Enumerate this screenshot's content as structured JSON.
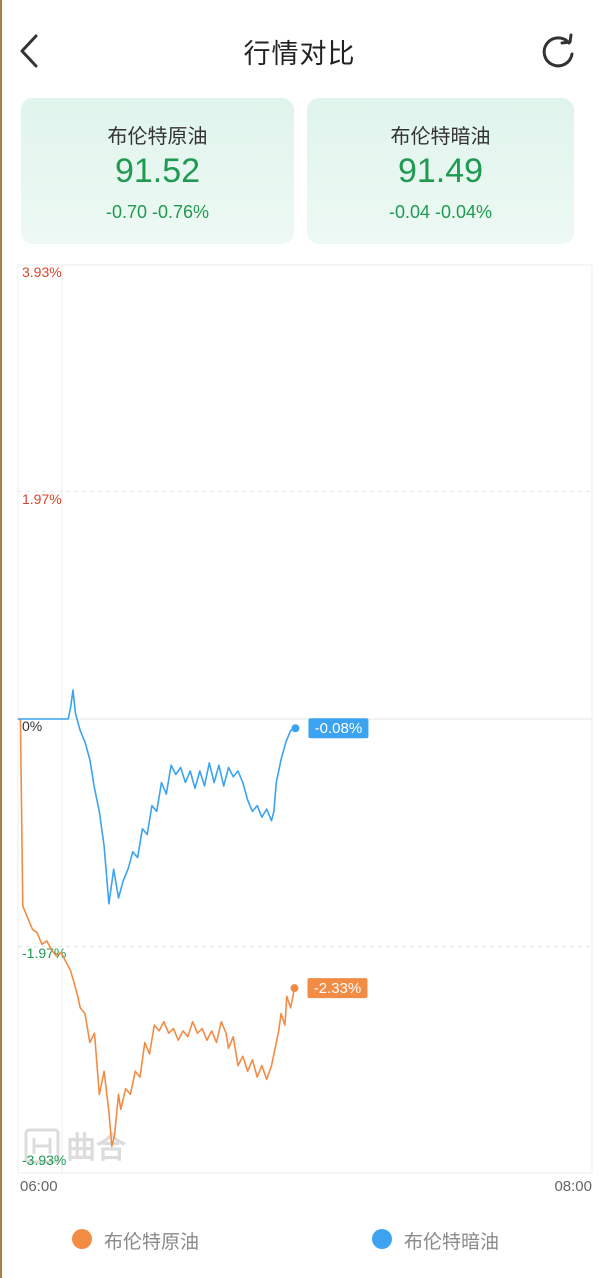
{
  "header": {
    "title": "行情对比",
    "back_icon": "chevron-left-icon",
    "refresh_icon": "refresh-icon"
  },
  "cards": [
    {
      "name": "布伦特原油",
      "price": "91.52",
      "change": "-0.70 -0.76%"
    },
    {
      "name": "布伦特暗油",
      "price": "91.49",
      "change": "-0.04 -0.04%"
    }
  ],
  "colors": {
    "down_green": "#1f9a50",
    "up_red": "#d9452b",
    "series_a": "#f28c45",
    "series_b": "#3ba3f0"
  },
  "chart_data": {
    "type": "line",
    "yaxis_labels": [
      "3.93%",
      "1.97%",
      "0%",
      "-1.97%",
      "-3.93%"
    ],
    "ylim": [
      -3.93,
      3.93
    ],
    "xaxis_labels": [
      "06:00",
      "08:00"
    ],
    "xlim": [
      0,
      120
    ],
    "grid": true,
    "legend_position": "bottom",
    "watermark": "曲合",
    "series": [
      {
        "name": "布伦特原油",
        "color": "#f28c45",
        "last_label": "-2.33%",
        "values": [
          [
            0,
            0.0
          ],
          [
            0.5,
            0.0
          ],
          [
            1,
            -1.62
          ],
          [
            2,
            -1.72
          ],
          [
            3,
            -1.82
          ],
          [
            4,
            -1.85
          ],
          [
            5,
            -1.95
          ],
          [
            6,
            -1.92
          ],
          [
            7,
            -2.0
          ],
          [
            8,
            -2.05
          ],
          [
            9,
            -2.02
          ],
          [
            10,
            -2.1
          ],
          [
            11,
            -2.18
          ],
          [
            11.7,
            -2.28
          ],
          [
            12.5,
            -2.4
          ],
          [
            13,
            -2.5
          ],
          [
            14,
            -2.55
          ],
          [
            15,
            -2.8
          ],
          [
            16,
            -2.72
          ],
          [
            17,
            -3.25
          ],
          [
            18,
            -3.05
          ],
          [
            19,
            -3.4
          ],
          [
            19.6,
            -3.7
          ],
          [
            20.2,
            -3.6
          ],
          [
            21,
            -3.25
          ],
          [
            21.5,
            -3.38
          ],
          [
            22.5,
            -3.2
          ],
          [
            23.5,
            -3.25
          ],
          [
            24.5,
            -3.05
          ],
          [
            25.5,
            -3.1
          ],
          [
            26.5,
            -2.8
          ],
          [
            27.5,
            -2.9
          ],
          [
            28.5,
            -2.65
          ],
          [
            29.5,
            -2.7
          ],
          [
            30.5,
            -2.62
          ],
          [
            31.5,
            -2.72
          ],
          [
            32.5,
            -2.68
          ],
          [
            33.5,
            -2.78
          ],
          [
            34.5,
            -2.7
          ],
          [
            35.5,
            -2.75
          ],
          [
            36.5,
            -2.62
          ],
          [
            37.5,
            -2.72
          ],
          [
            38.5,
            -2.68
          ],
          [
            39.5,
            -2.78
          ],
          [
            40.5,
            -2.7
          ],
          [
            41.5,
            -2.8
          ],
          [
            42.5,
            -2.62
          ],
          [
            43.5,
            -2.72
          ],
          [
            44,
            -2.85
          ],
          [
            45,
            -2.75
          ],
          [
            46,
            -3.0
          ],
          [
            47,
            -2.92
          ],
          [
            48,
            -3.05
          ],
          [
            49,
            -2.95
          ],
          [
            50,
            -3.1
          ],
          [
            51,
            -3.0
          ],
          [
            52,
            -3.12
          ],
          [
            53,
            -3.0
          ],
          [
            53.5,
            -2.9
          ],
          [
            54.5,
            -2.7
          ],
          [
            55,
            -2.55
          ],
          [
            55.8,
            -2.65
          ],
          [
            56.2,
            -2.4
          ],
          [
            57,
            -2.5
          ],
          [
            57.8,
            -2.33
          ]
        ]
      },
      {
        "name": "布伦特暗油",
        "color": "#3ba3f0",
        "last_label": "-0.08%",
        "values": [
          [
            0,
            0.0
          ],
          [
            10.5,
            0.0
          ],
          [
            11,
            0.1
          ],
          [
            11.5,
            0.25
          ],
          [
            12,
            0.05
          ],
          [
            13,
            -0.1
          ],
          [
            14,
            -0.2
          ],
          [
            15,
            -0.35
          ],
          [
            16,
            -0.6
          ],
          [
            17,
            -0.8
          ],
          [
            18,
            -1.1
          ],
          [
            19,
            -1.6
          ],
          [
            20,
            -1.3
          ],
          [
            21,
            -1.55
          ],
          [
            22,
            -1.4
          ],
          [
            23,
            -1.3
          ],
          [
            24,
            -1.15
          ],
          [
            25,
            -1.2
          ],
          [
            26,
            -0.95
          ],
          [
            27,
            -1.0
          ],
          [
            28,
            -0.75
          ],
          [
            29,
            -0.8
          ],
          [
            30,
            -0.55
          ],
          [
            31,
            -0.65
          ],
          [
            32,
            -0.4
          ],
          [
            33,
            -0.48
          ],
          [
            34,
            -0.42
          ],
          [
            35,
            -0.55
          ],
          [
            36,
            -0.45
          ],
          [
            37,
            -0.6
          ],
          [
            38,
            -0.45
          ],
          [
            39,
            -0.58
          ],
          [
            40,
            -0.38
          ],
          [
            41,
            -0.55
          ],
          [
            42,
            -0.4
          ],
          [
            43,
            -0.58
          ],
          [
            44,
            -0.42
          ],
          [
            45,
            -0.5
          ],
          [
            46,
            -0.45
          ],
          [
            47,
            -0.55
          ],
          [
            48,
            -0.7
          ],
          [
            49,
            -0.8
          ],
          [
            50,
            -0.75
          ],
          [
            51,
            -0.85
          ],
          [
            52,
            -0.78
          ],
          [
            53,
            -0.88
          ],
          [
            53.5,
            -0.8
          ],
          [
            54,
            -0.55
          ],
          [
            55,
            -0.35
          ],
          [
            56,
            -0.2
          ],
          [
            57,
            -0.1
          ],
          [
            58,
            -0.08
          ]
        ]
      }
    ]
  },
  "legend": [
    {
      "label": "布伦特原油",
      "color": "#f28c45"
    },
    {
      "label": "布伦特暗油",
      "color": "#3ba3f0"
    }
  ]
}
